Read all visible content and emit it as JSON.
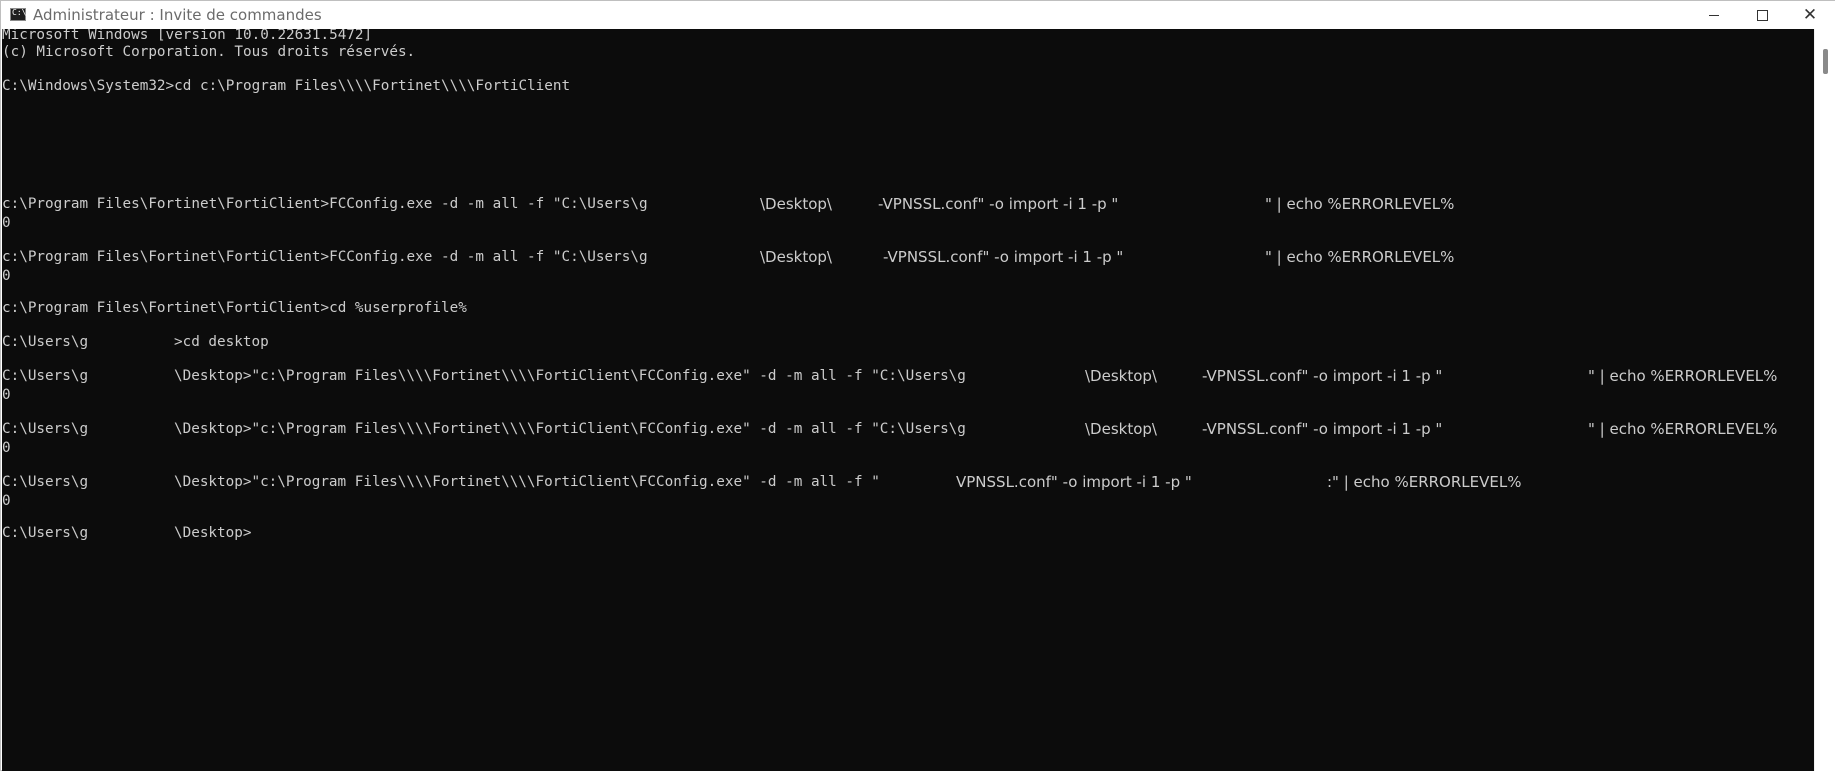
{
  "window": {
    "title": "Administrateur : Invite de commandes",
    "icon": "cmd-icon",
    "icon_text": "C:\\.",
    "minimize_icon": "minimize-icon",
    "maximize_icon": "maximize-icon",
    "close_icon": "close-icon",
    "close_glyph": "✕"
  },
  "console": {
    "background": "#0c0c0c",
    "foreground": "#cccccc",
    "header": {
      "version_line": "Microsoft Windows [version 10.0.22631.5472]",
      "copyright_line": "(c) Microsoft Corporation. Tous droits réservés."
    },
    "cd_command": "C:\\Windows\\System32>cd c:\\Program Files\\\\\\\\Fortinet\\\\\\\\FortiClient",
    "cmd1": {
      "prompt": "c:\\Program Files\\Fortinet\\FortiClient>FCConfig.exe -d -m all -f \"C:\\Users\\g",
      "mid": "\\Desktop\\",
      "tail": "-VPNSSL.conf\" -o import -i 1 -p \"",
      "end": "\" | echo %ERRORLEVEL%",
      "result": "0"
    },
    "cmd2": {
      "prompt": "c:\\Program Files\\Fortinet\\FortiClient>FCConfig.exe -d -m all -f \"C:\\Users\\g",
      "mid": "\\Desktop\\",
      "tail": "-VPNSSL.conf\" -o import -i 1 -p \"",
      "end": "\" | echo %ERRORLEVEL%",
      "result": "0"
    },
    "cd_userprofile": "c:\\Program Files\\Fortinet\\FortiClient>cd %userprofile%",
    "cd_desktop": {
      "user": "C:\\Users\\g",
      "command": ">cd desktop"
    },
    "cmd3": {
      "user": "C:\\Users\\g",
      "prompt": "\\Desktop>\"c:\\Program Files\\\\\\\\Fortinet\\\\\\\\FortiClient\\FCConfig.exe\" -d -m all -f \"C:\\Users\\g",
      "mid": "\\Desktop\\",
      "tail": "-VPNSSL.conf\" -o import -i 1 -p \"",
      "end": "\" | echo %ERRORLEVEL%",
      "result": "0"
    },
    "cmd4": {
      "user": "C:\\Users\\g",
      "prompt": "\\Desktop>\"c:\\Program Files\\\\\\\\Fortinet\\\\\\\\FortiClient\\FCConfig.exe\" -d -m all -f \"C:\\Users\\g",
      "mid": "\\Desktop\\",
      "tail": "-VPNSSL.conf\" -o import -i 1 -p \"",
      "end": "\" | echo %ERRORLEVEL%",
      "result": "0"
    },
    "cmd5": {
      "user": "C:\\Users\\g",
      "prompt": "\\Desktop>\"c:\\Program Files\\\\\\\\Fortinet\\\\\\\\FortiClient\\FCConfig.exe\" -d -m all -f \"",
      "tail": "VPNSSL.conf\" -o import -i 1 -p \"",
      "end": ":\" | echo %ERRORLEVEL%",
      "result": "0"
    },
    "final_prompt": {
      "user": "C:\\Users\\g",
      "path": "\\Desktop>"
    }
  }
}
